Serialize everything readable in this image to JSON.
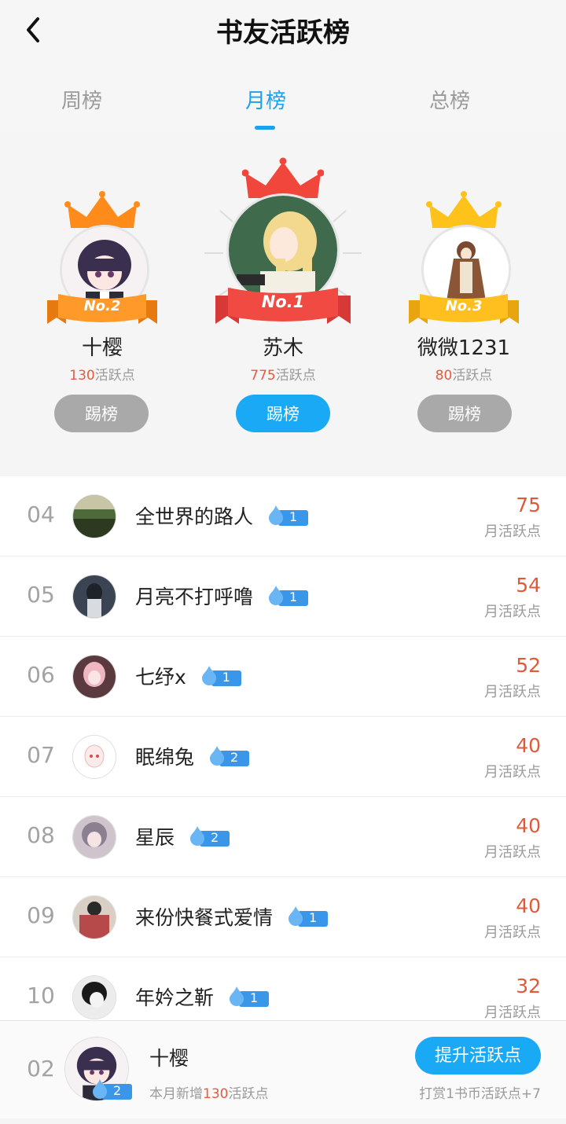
{
  "header": {
    "title": "书友活跃榜"
  },
  "tabs": [
    {
      "label": "周榜",
      "active": false
    },
    {
      "label": "月榜",
      "active": true
    },
    {
      "label": "总榜",
      "active": false
    }
  ],
  "podium": {
    "first": {
      "rank_label": "No.1",
      "name": "苏木",
      "points": "775",
      "points_suffix": "活跃点",
      "button": "踢榜"
    },
    "second": {
      "rank_label": "No.2",
      "name": "十樱",
      "points": "130",
      "points_suffix": "活跃点",
      "button": "踢榜"
    },
    "third": {
      "rank_label": "No.3",
      "name": "微微1231",
      "points": "80",
      "points_suffix": "活跃点",
      "button": "踢榜"
    }
  },
  "list": [
    {
      "rank": "04",
      "name": "全世界的路人",
      "level": "1",
      "value": "75",
      "unit": "月活跃点"
    },
    {
      "rank": "05",
      "name": "月亮不打呼噜",
      "level": "1",
      "value": "54",
      "unit": "月活跃点"
    },
    {
      "rank": "06",
      "name": "七纾x",
      "level": "1",
      "value": "52",
      "unit": "月活跃点"
    },
    {
      "rank": "07",
      "name": "眠绵兔",
      "level": "2",
      "value": "40",
      "unit": "月活跃点"
    },
    {
      "rank": "08",
      "name": "星辰",
      "level": "2",
      "value": "40",
      "unit": "月活跃点"
    },
    {
      "rank": "09",
      "name": "来份快餐式爱情",
      "level": "1",
      "value": "40",
      "unit": "月活跃点"
    },
    {
      "rank": "10",
      "name": "年妗之靳",
      "level": "1",
      "value": "32",
      "unit": "月活跃点"
    }
  ],
  "me": {
    "rank": "02",
    "name": "十樱",
    "level": "2",
    "sub_prefix": "本月新增",
    "sub_points": "130",
    "sub_suffix": "活跃点",
    "boost_button": "提升活跃点",
    "tip": "打赏1书币活跃点+7"
  },
  "colors": {
    "accent": "#1aa1f0",
    "points": "#e05a3a",
    "badge": "#3a96e8"
  }
}
